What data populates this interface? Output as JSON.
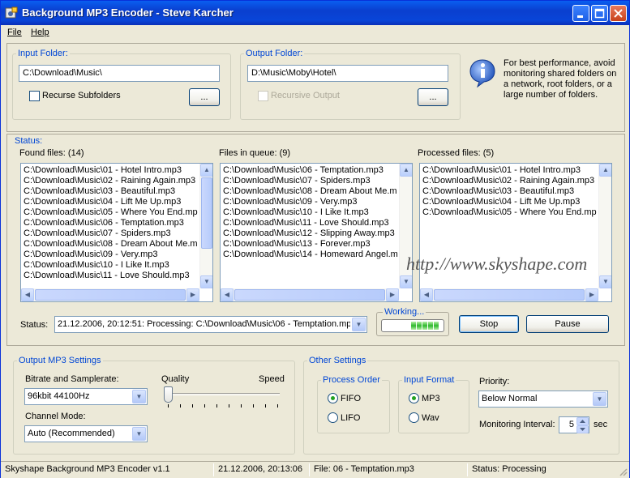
{
  "window": {
    "title": "Background MP3 Encoder - Steve Karcher"
  },
  "menu": {
    "file": "File",
    "help": "Help"
  },
  "input_folder": {
    "legend": "Input Folder:",
    "path": "C:\\Download\\Music\\",
    "recurse_label": "Recurse Subfolders",
    "browse_label": "..."
  },
  "output_folder": {
    "legend": "Output Folder:",
    "path": "D:\\Music\\Moby\\Hotel\\",
    "recursive_label": "Recursive Output",
    "browse_label": "..."
  },
  "info_text": "For best performance, avoid monitoring shared folders on a network, root folders, or a large number of folders.",
  "status_section": {
    "legend": "Status:",
    "found": {
      "label": "Found files: (14)",
      "items": [
        "C:\\Download\\Music\\01 - Hotel Intro.mp3",
        "C:\\Download\\Music\\02 - Raining Again.mp3",
        "C:\\Download\\Music\\03 - Beautiful.mp3",
        "C:\\Download\\Music\\04 - Lift Me Up.mp3",
        "C:\\Download\\Music\\05 - Where You End.mp",
        "C:\\Download\\Music\\06 - Temptation.mp3",
        "C:\\Download\\Music\\07 - Spiders.mp3",
        "C:\\Download\\Music\\08 - Dream About Me.m",
        "C:\\Download\\Music\\09 - Very.mp3",
        "C:\\Download\\Music\\10 - I Like It.mp3",
        "C:\\Download\\Music\\11 - Love Should.mp3"
      ]
    },
    "queue": {
      "label": "Files in queue: (9)",
      "items": [
        "C:\\Download\\Music\\06 - Temptation.mp3",
        "C:\\Download\\Music\\07 - Spiders.mp3",
        "C:\\Download\\Music\\08 - Dream About Me.m",
        "C:\\Download\\Music\\09 - Very.mp3",
        "C:\\Download\\Music\\10 - I Like It.mp3",
        "C:\\Download\\Music\\11 - Love Should.mp3",
        "C:\\Download\\Music\\12 - Slipping Away.mp3",
        "C:\\Download\\Music\\13 - Forever.mp3",
        "C:\\Download\\Music\\14 - Homeward Angel.m"
      ]
    },
    "processed": {
      "label": "Processed files: (5)",
      "items": [
        "C:\\Download\\Music\\01 - Hotel Intro.mp3",
        "C:\\Download\\Music\\02 - Raining Again.mp3",
        "C:\\Download\\Music\\03 - Beautiful.mp3",
        "C:\\Download\\Music\\04 - Lift Me Up.mp3",
        "C:\\Download\\Music\\05 - Where You End.mp"
      ]
    },
    "watermark": "http://www.skyshape.com",
    "status_label": "Status:",
    "status_value": "21.12.2006, 20:12:51: Processing: C:\\Download\\Music\\06 - Temptation.mp",
    "working_label": "Working...",
    "stop_label": "Stop",
    "pause_label": "Pause"
  },
  "output_settings": {
    "legend": "Output MP3 Settings",
    "bitrate_label": "Bitrate and Samplerate:",
    "bitrate_value": "96kbit 44100Hz",
    "channel_label": "Channel Mode:",
    "channel_value": "Auto (Recommended)",
    "quality_label": "Quality",
    "speed_label": "Speed"
  },
  "other_settings": {
    "legend": "Other Settings",
    "process_order": {
      "legend": "Process Order",
      "fifo": "FIFO",
      "lifo": "LIFO",
      "selected": "FIFO"
    },
    "input_format": {
      "legend": "Input Format",
      "mp3": "MP3",
      "wav": "Wav",
      "selected": "MP3"
    },
    "priority_label": "Priority:",
    "priority_value": "Below Normal",
    "interval_label": "Monitoring Interval:",
    "interval_value": "5",
    "interval_unit": "sec"
  },
  "statusbar": {
    "app": "Skyshape Background MP3 Encoder v1.1",
    "time": "21.12.2006, 20:13:06",
    "file": "File: 06 - Temptation.mp3",
    "status": "Status: Processing"
  }
}
